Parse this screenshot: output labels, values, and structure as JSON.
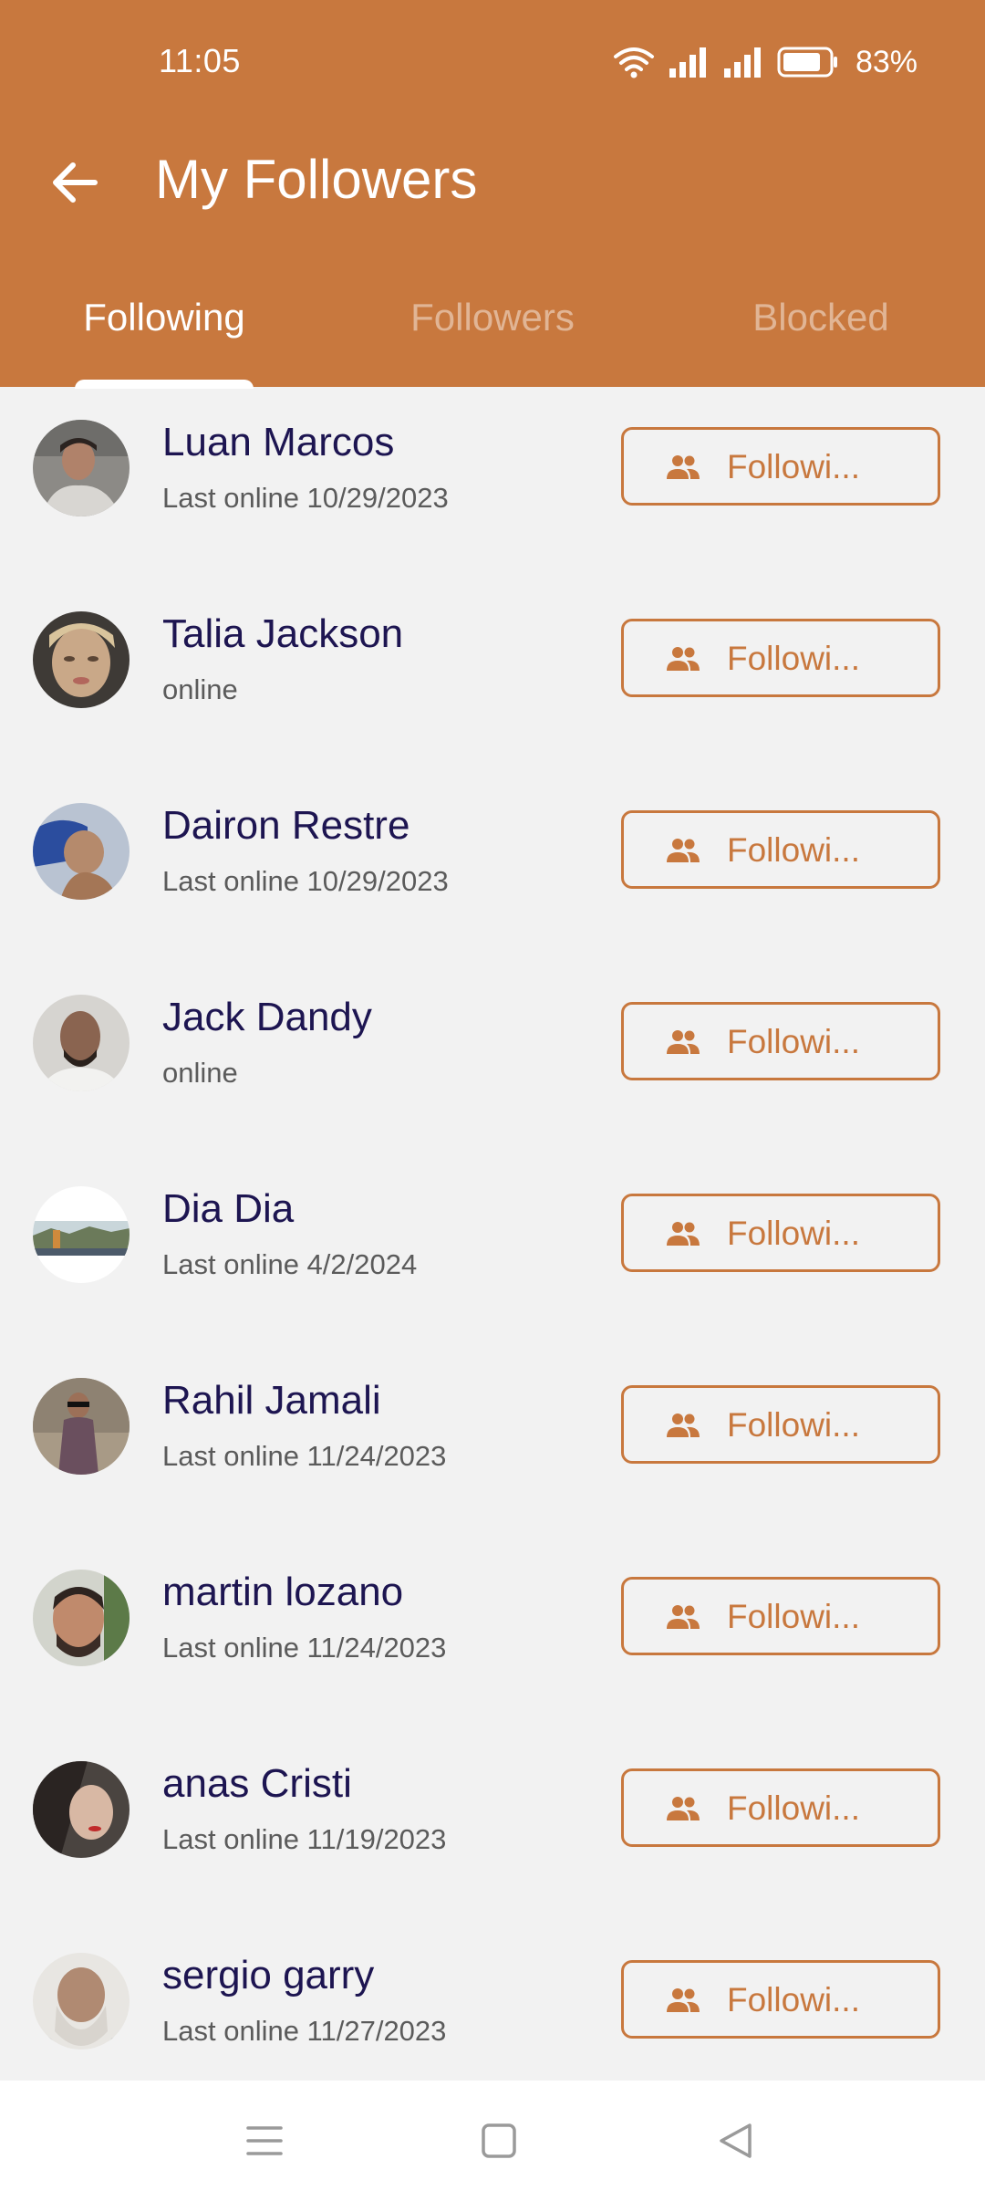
{
  "status_bar": {
    "time": "11:05",
    "battery": "83%",
    "icons": [
      "wifi-icon",
      "signal-icon",
      "signal-icon",
      "battery-icon"
    ]
  },
  "header": {
    "title": "My Followers",
    "back_icon": "arrow-left-icon",
    "tabs": [
      {
        "label": "Following",
        "active": true
      },
      {
        "label": "Followers",
        "active": false
      },
      {
        "label": "Blocked",
        "active": false
      }
    ]
  },
  "colors": {
    "accent": "#c8783e",
    "name_text": "#1d1551",
    "status_text": "#5b5b5b",
    "background": "#f2f2f2"
  },
  "users": [
    {
      "name": "Luan Marcos",
      "status": "Last online 10/29/2023",
      "button": "Followi..."
    },
    {
      "name": "Talia Jackson",
      "status": "online",
      "button": "Followi..."
    },
    {
      "name": "Dairon Restre",
      "status": "Last online 10/29/2023",
      "button": "Followi..."
    },
    {
      "name": "Jack Dandy",
      "status": "online",
      "button": "Followi..."
    },
    {
      "name": "Dia Dia",
      "status": "Last online 4/2/2024",
      "button": "Followi..."
    },
    {
      "name": "Rahil Jamali",
      "status": "Last online 11/24/2023",
      "button": "Followi..."
    },
    {
      "name": "martin lozano",
      "status": "Last online 11/24/2023",
      "button": "Followi..."
    },
    {
      "name": "anas Cristi",
      "status": "Last online 11/19/2023",
      "button": "Followi..."
    },
    {
      "name": "sergio garry",
      "status": "Last online 11/27/2023",
      "button": "Followi..."
    }
  ],
  "nav_bar": {
    "icons": [
      "menu-icon",
      "home-square-icon",
      "back-triangle-icon"
    ]
  }
}
